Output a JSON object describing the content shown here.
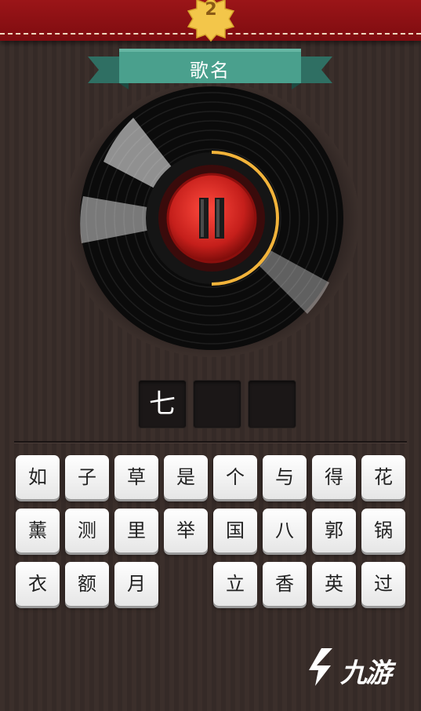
{
  "level": "2",
  "title": "歌名",
  "answer_slots": [
    "七",
    "",
    ""
  ],
  "keyboard": [
    [
      "如",
      "子",
      "草",
      "是",
      "个",
      "与",
      "得",
      "花"
    ],
    [
      "薰",
      "测",
      "里",
      "举",
      "国",
      "八",
      "郭",
      "锅"
    ],
    [
      "衣",
      "额",
      "月",
      "",
      "立",
      "香",
      "英",
      "过"
    ]
  ],
  "watermark": "九游",
  "colors": {
    "header": "#8b1014",
    "ribbon": "#3f8f7f",
    "badge": "#f3c64a",
    "play_button": "#d42a26"
  },
  "player_state": "playing",
  "icons": {
    "play_control": "pause-icon",
    "brand_logo": "jiuyou-logo-icon"
  }
}
